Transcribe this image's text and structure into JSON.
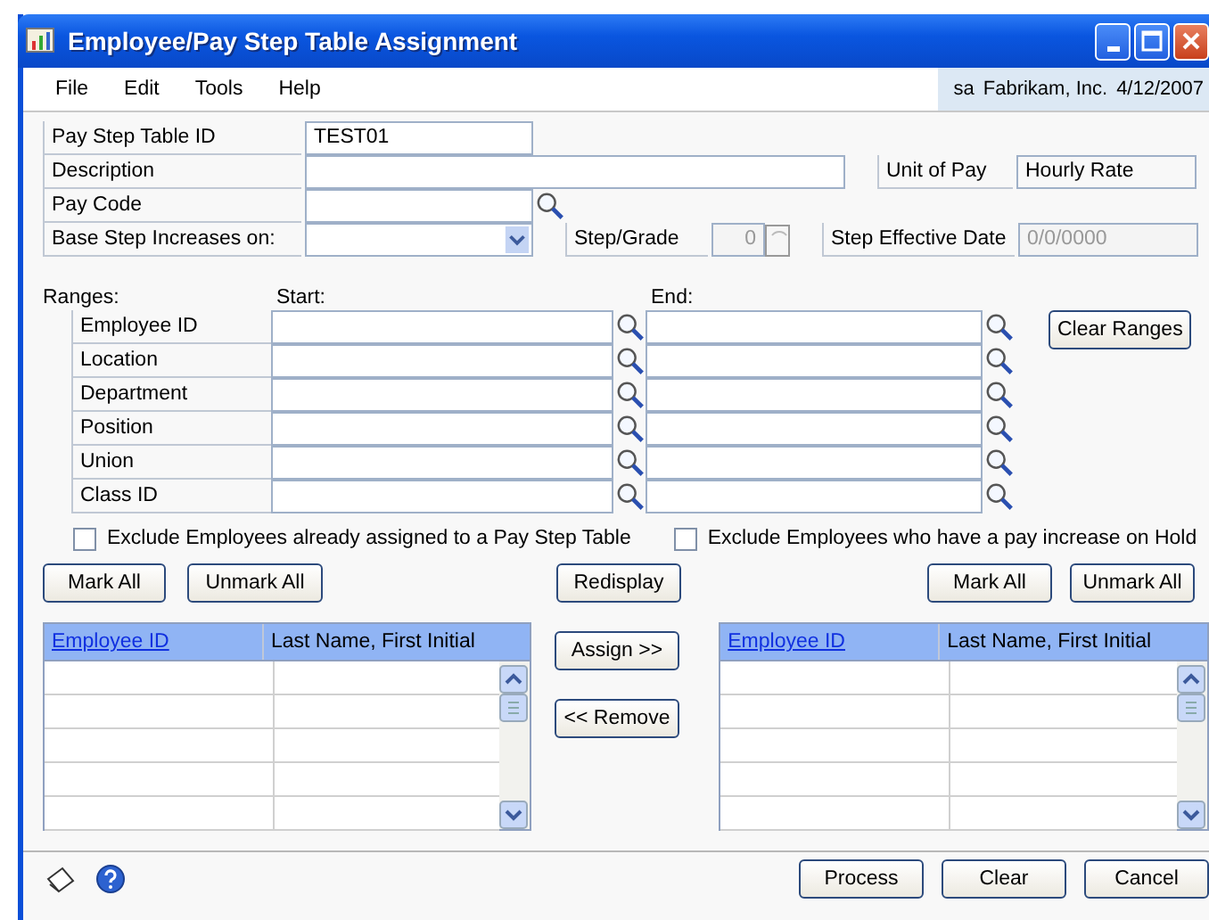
{
  "window": {
    "title": "Employee/Pay Step Table Assignment"
  },
  "menu": [
    "File",
    "Edit",
    "Tools",
    "Help"
  ],
  "session": {
    "user": "sa",
    "company": "Fabrikam, Inc.",
    "date": "4/12/2007"
  },
  "form": {
    "pay_step_table_id": {
      "label": "Pay Step Table ID",
      "value": "TEST01"
    },
    "description": {
      "label": "Description"
    },
    "unit_of_pay": {
      "label": "Unit of Pay",
      "value": "Hourly Rate"
    },
    "pay_code": {
      "label": "Pay Code"
    },
    "base_step_increases_on": {
      "label": "Base Step Increases on:"
    },
    "step_grade": {
      "label": "Step/Grade",
      "value": "0",
      "disabled": true
    },
    "step_effective_date": {
      "label": "Step Effective Date",
      "value": "0/0/0000",
      "disabled": true
    }
  },
  "ranges": {
    "label": "Ranges:",
    "start_label": "Start:",
    "end_label": "End:",
    "rows": [
      "Employee ID",
      "Location",
      "Department",
      "Position",
      "Union",
      "Class ID"
    ],
    "clear_button": "Clear Ranges"
  },
  "options": [
    {
      "label": "Exclude Employees already assigned to a Pay Step Table",
      "checked": false
    },
    {
      "label": "Exclude Employees who have a pay increase on Hold",
      "checked": false
    }
  ],
  "left_buttons": [
    "Mark All",
    "Unmark All"
  ],
  "redisplay_button": "Redisplay",
  "right_buttons": [
    "Mark All",
    "Unmark All"
  ],
  "lists": [
    {
      "columns": [
        "Employee ID",
        "Last Name, First Initial"
      ]
    },
    {
      "columns": [
        "Employee ID",
        "Last Name, First Initial"
      ]
    }
  ],
  "transfer_buttons": [
    "Assign >>",
    "<< Remove"
  ],
  "footer_buttons": [
    "Process",
    "Clear",
    "Cancel"
  ]
}
